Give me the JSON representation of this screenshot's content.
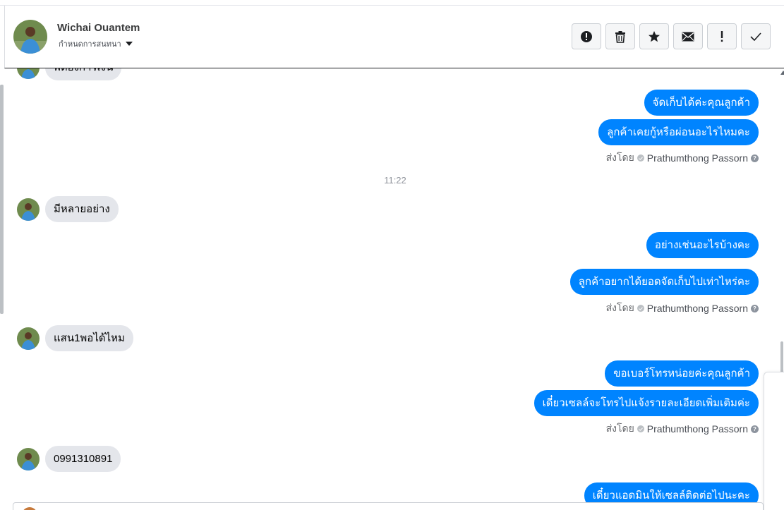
{
  "contact": {
    "name": "Wichai Ouantem",
    "assign_label": "กำหนดการสนทนา"
  },
  "toolbar": {
    "buttons": [
      {
        "name": "spam-button",
        "icon": "alert-circle-icon"
      },
      {
        "name": "delete-button",
        "icon": "trash-icon"
      },
      {
        "name": "star-button",
        "icon": "star-icon"
      },
      {
        "name": "mark-unread-button",
        "icon": "envelope-icon"
      },
      {
        "name": "follow-up-button",
        "icon": "exclamation-icon"
      },
      {
        "name": "done-button",
        "icon": "checkmark-icon"
      }
    ]
  },
  "messages": {
    "top_cut_in": "พี่ต้องการเงิน",
    "out_1": "จัดเก็บได้ค่ะคุณลูกค้า",
    "out_2": "ลูกค้าเคยกู้หรือผ่อนอะไรไหมคะ",
    "timestamp_1": "11:22",
    "in_1": "มีหลายอย่าง",
    "out_3": "อย่างเช่นอะไรบ้างคะ",
    "out_4": "ลูกค้าอยากได้ยอดจัดเก็บไปเท่าไหร่คะ",
    "in_2": "แสน1พอได้ไหม",
    "out_5": "ขอเบอร์โทรหน่อยค่ะคุณลูกค้า",
    "out_6": "เดี๋ยวเซลล์จะโทรไปแจ้งรายละเอียดเพิ่มเติมค่ะ",
    "in_3": "0991310891",
    "out_7_cut": "เดี๋ยวแอดมินให้เซลล์ติดต่อไปนะคะ"
  },
  "sent_by": {
    "prefix": "ส่งโดย",
    "agent": "Prathumthong Passorn",
    "help": "?"
  },
  "colors": {
    "outgoing_bubble": "#0084ff",
    "incoming_bubble": "#e4e6eb",
    "header_border": "#1c1e21"
  }
}
